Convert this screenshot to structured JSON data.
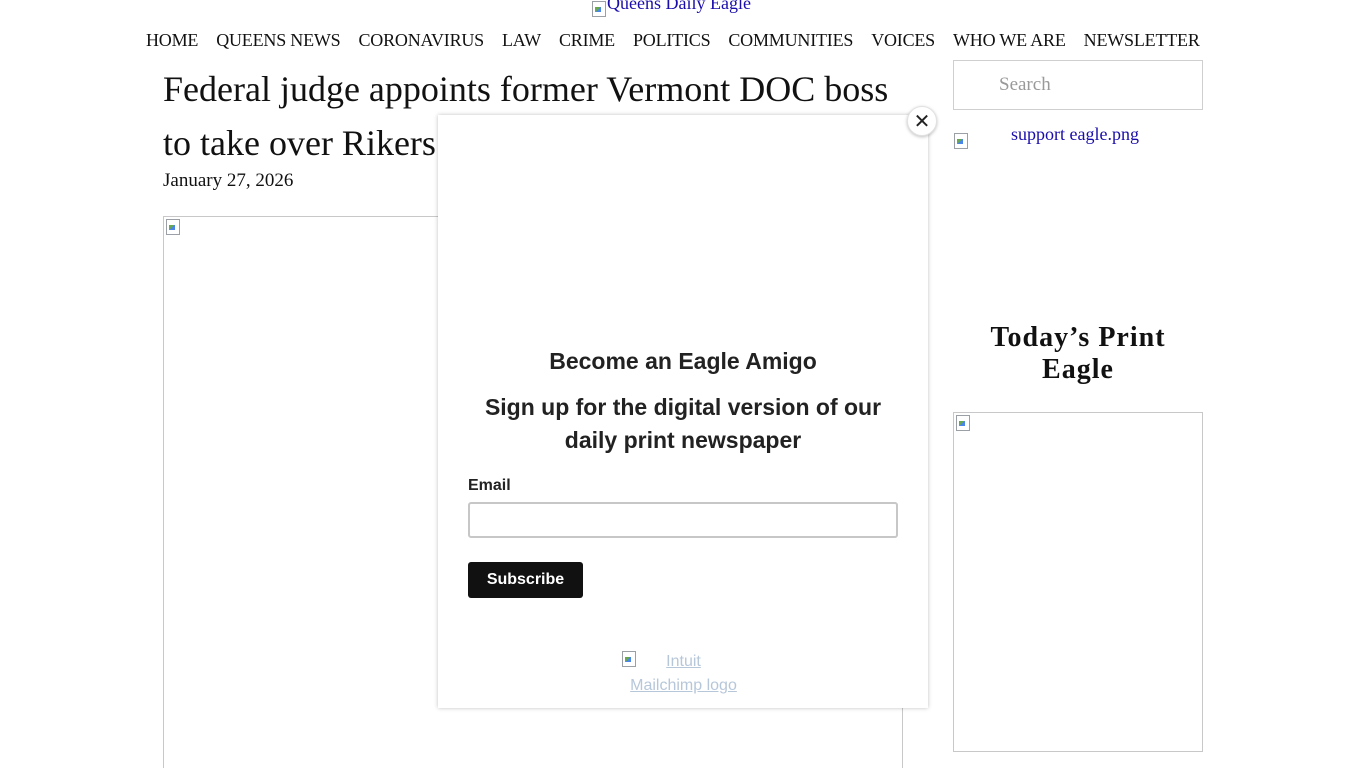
{
  "header": {
    "logo_alt": "Queens Daily Eagle"
  },
  "nav": {
    "items": [
      {
        "label": "HOME"
      },
      {
        "label": "QUEENS NEWS"
      },
      {
        "label": "CORONAVIRUS"
      },
      {
        "label": "LAW"
      },
      {
        "label": "CRIME"
      },
      {
        "label": "POLITICS"
      },
      {
        "label": "COMMUNITIES"
      },
      {
        "label": "VOICES"
      },
      {
        "label": "WHO WE ARE"
      },
      {
        "label": "NEWSLETTER"
      }
    ]
  },
  "article": {
    "headline": "Federal judge appoints former Vermont DOC boss to take over Rikers",
    "date": "January 27, 2026"
  },
  "sidebar": {
    "search_placeholder": "Search",
    "support_image_alt": "support eagle.png",
    "print_title": "Today’s Print Eagle"
  },
  "popup": {
    "close_symbol": "✕",
    "title": "Become an Eagle Amigo",
    "subtitle": "Sign up for the digital version of our daily print newspaper",
    "email_label": "Email",
    "email_value": "",
    "subscribe_label": "Subscribe",
    "logo_alt_line1": "Intuit",
    "logo_alt_line2": "Mailchimp logo"
  },
  "colors": {
    "link": "#1a0dab",
    "button_bg": "#111111",
    "button_text": "#ffffff"
  }
}
